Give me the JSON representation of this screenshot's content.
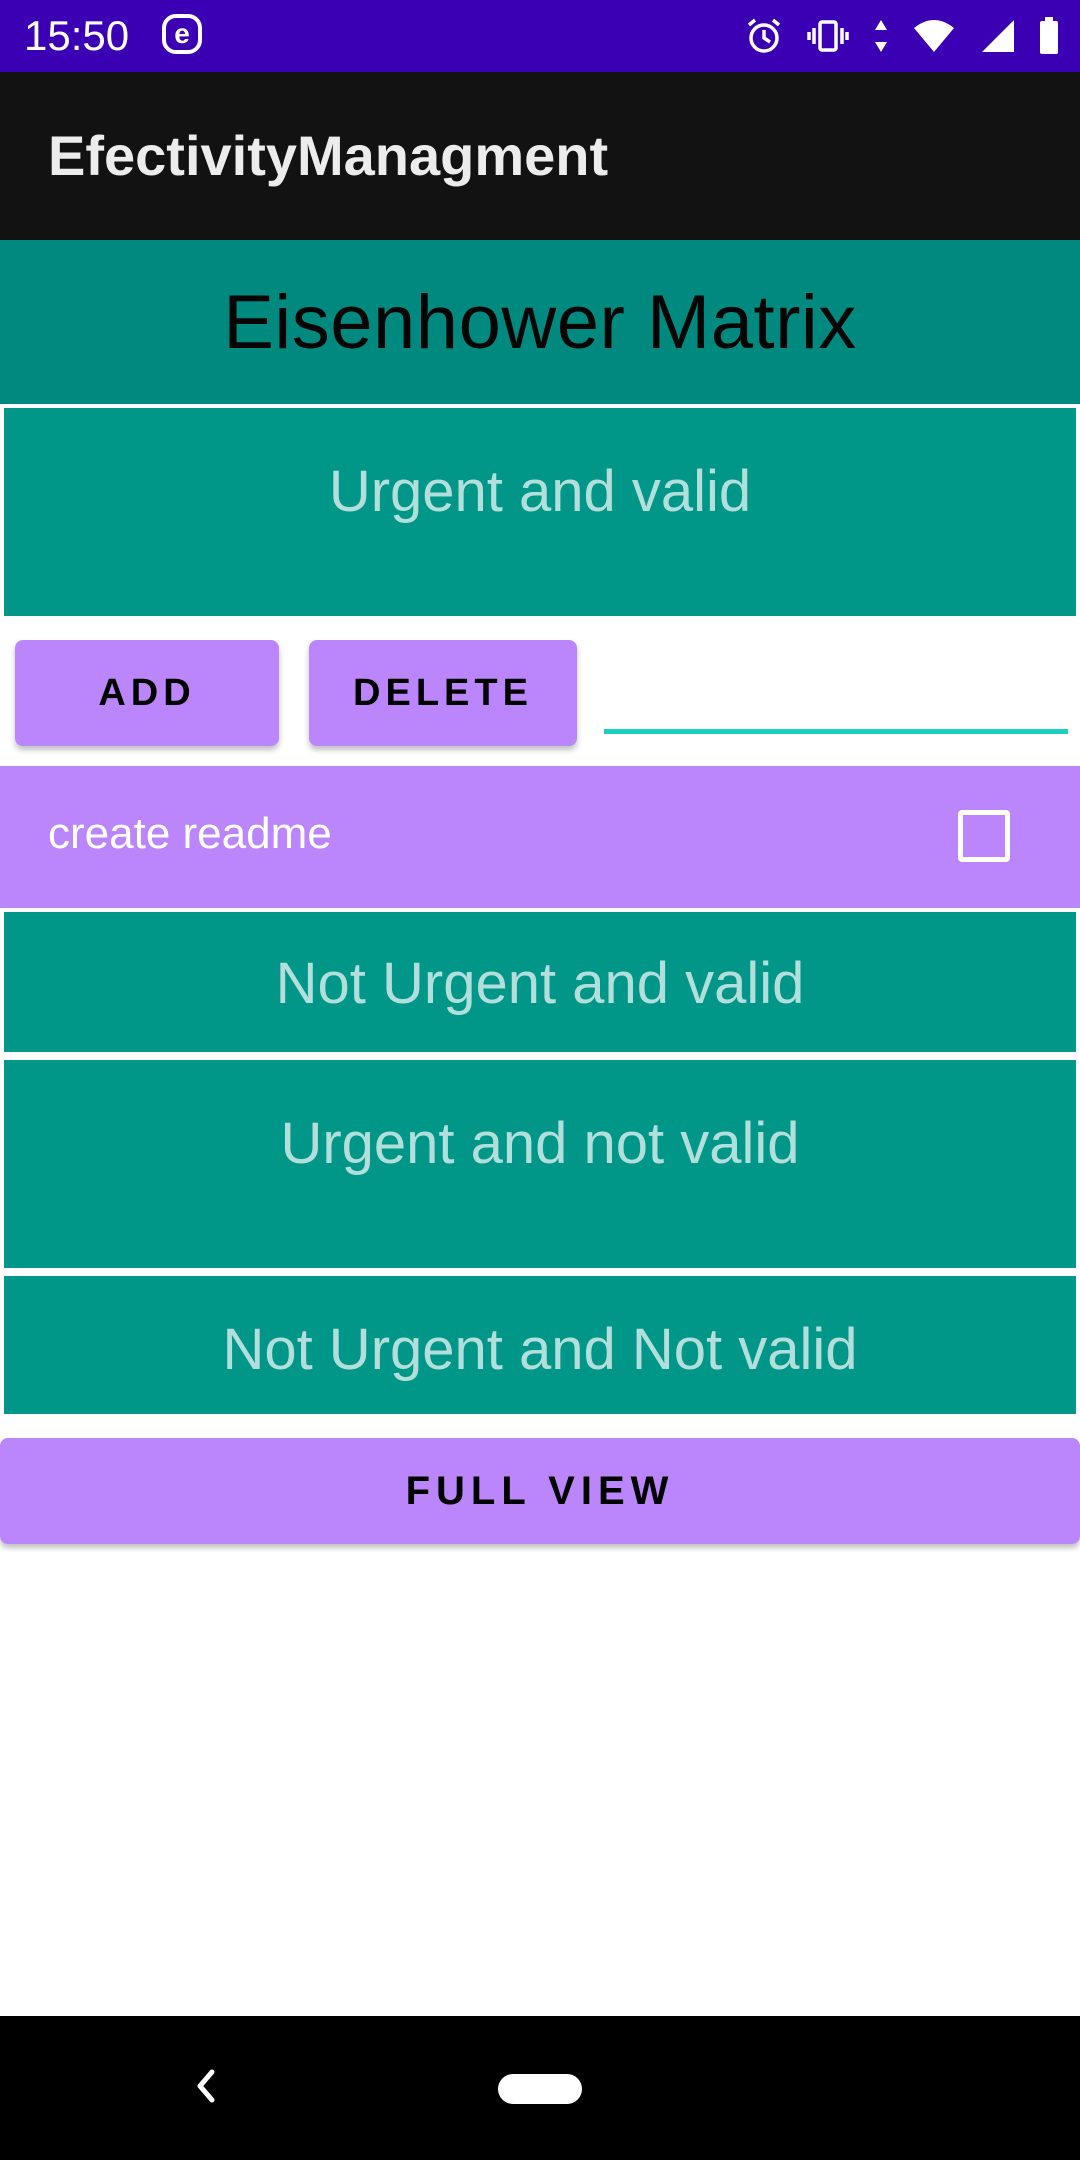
{
  "status_bar": {
    "time": "15:50",
    "app_icon_letter": "e",
    "icons": [
      "alarm-icon",
      "vibrate-icon",
      "data-arrows-icon",
      "wifi-icon",
      "cell-signal-icon",
      "battery-icon"
    ]
  },
  "app_bar": {
    "title": "EfectivityManagment"
  },
  "matrix": {
    "title": "Eisenhower Matrix",
    "quadrants": [
      {
        "label": "Urgent and valid"
      },
      {
        "label": "Not Urgent and valid"
      },
      {
        "label": "Urgent and  not valid"
      },
      {
        "label": "Not Urgent and Not valid"
      }
    ]
  },
  "actions": {
    "add_label": "ADD",
    "delete_label": "DELETE",
    "input_value": "",
    "input_placeholder": ""
  },
  "tasks": [
    {
      "label": "create readme",
      "checked": false
    }
  ],
  "footer": {
    "full_view_label": "FULL VIEW"
  },
  "colors": {
    "status_bar": "#3b00b3",
    "app_bar": "#121212",
    "header": "#00897f",
    "quadrant": "#009688",
    "quadrant_text": "#b2dfdb",
    "accent_purple": "#bb86fc",
    "input_underline": "#1ccfbf"
  }
}
